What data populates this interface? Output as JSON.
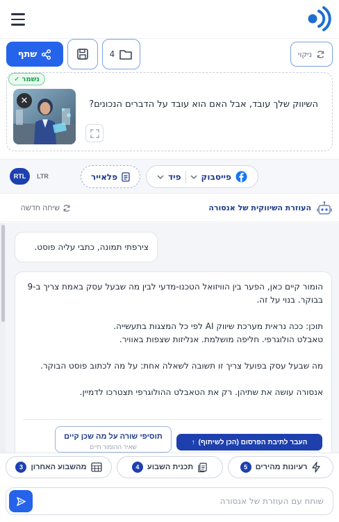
{
  "header": {
    "logo_icon": "sound-wave-logo-icon",
    "menu_icon": "hamburger-icon"
  },
  "toolbar": {
    "share_label": "שתף",
    "folder_count": "4",
    "clean_label": "ניקוי"
  },
  "post": {
    "saved_badge": "נשמר",
    "text": "השיווק שלך עובד, אבל האם הוא עובד על הדברים הנכונים?"
  },
  "platform": {
    "network_label": "פייסבוק",
    "format_label": "פיד",
    "flyer_label": "פלאייר",
    "rtl_label": "RTL",
    "ltr_label": "LTR"
  },
  "assistant": {
    "title": "העוזרת השיווקית של אנסורה",
    "new_chat_label": "שיחה חדשה"
  },
  "chat": {
    "user_message": "צירפתי תמונה, כתבי עליה פוסט.",
    "ai_paragraphs": [
      "הומור קיים כאן, הפער בין הוויזואל הטכנו-מדעי לבין מה שבעל עסק באמת צריך ב-9 בבוקר. בנוי על זה.",
      "תוכן: ככה נראית מערכת שיווק AI לפי כל המצגות בתעשייה.\nטאבלט הולוגרפי. חליפה מושלמת. אנליזות שצפות באוויר.",
      "מה שבעל עסק בפועל צריך זו תשובה לשאלה אחת: על מה לכתוב פוסט הבוקר.",
      "אנסורה עושה את שתיהן. רק את הטאבלט ההולוגרפי תצטרכו לדמיין."
    ],
    "transfer_label": "העבר לתיבת הפרסום (הכן לשיתוף)",
    "addline_label": "תוסיפי שורה על מה שכן קיים",
    "addline_sub": "שאיר ההומור חיים"
  },
  "quick_actions": [
    {
      "label": "רעיונות מהירים",
      "count": "5"
    },
    {
      "label": "תכנית השבוע",
      "count": "4"
    },
    {
      "label": "מהשבוע האחרון",
      "count": "3"
    }
  ],
  "input": {
    "placeholder": "שוחח עם העוזרת של אנסורה"
  },
  "colors": {
    "accent": "#2563eb",
    "navy": "#1e40af",
    "success": "#16a34a",
    "facebook": "#1877f2"
  }
}
